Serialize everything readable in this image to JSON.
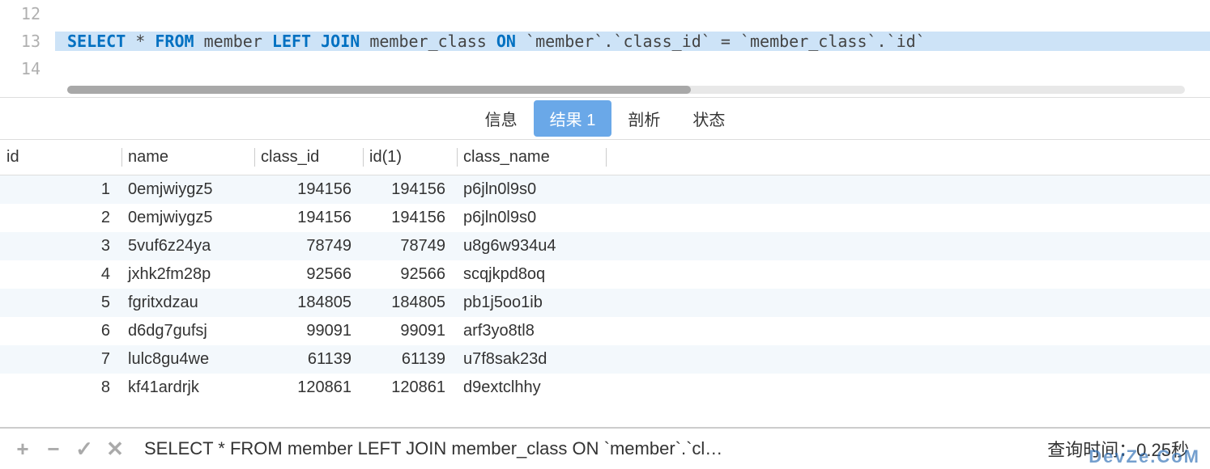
{
  "editor": {
    "lines": [
      {
        "num": "12",
        "tokens": []
      },
      {
        "num": "13",
        "selected": true,
        "sql": "SELECT * FROM member LEFT JOIN member_class ON `member`.`class_id` = `member_class`.`id`"
      },
      {
        "num": "14",
        "tokens": []
      }
    ]
  },
  "tabs": {
    "items": [
      {
        "label": "信息",
        "active": false
      },
      {
        "label": "结果 1",
        "active": true
      },
      {
        "label": "剖析",
        "active": false
      },
      {
        "label": "状态",
        "active": false
      }
    ]
  },
  "table": {
    "columns": [
      "id",
      "name",
      "class_id",
      "id(1)",
      "class_name"
    ],
    "rows": [
      {
        "id": "1",
        "name": "0emjwiygz5",
        "class_id": "194156",
        "id1": "194156",
        "class_name": "p6jln0l9s0"
      },
      {
        "id": "2",
        "name": "0emjwiygz5",
        "class_id": "194156",
        "id1": "194156",
        "class_name": "p6jln0l9s0"
      },
      {
        "id": "3",
        "name": "5vuf6z24ya",
        "class_id": "78749",
        "id1": "78749",
        "class_name": "u8g6w934u4"
      },
      {
        "id": "4",
        "name": "jxhk2fm28p",
        "class_id": "92566",
        "id1": "92566",
        "class_name": "scqjkpd8oq"
      },
      {
        "id": "5",
        "name": "fgritxdzau",
        "class_id": "184805",
        "id1": "184805",
        "class_name": "pb1j5oo1ib"
      },
      {
        "id": "6",
        "name": "d6dg7gufsj",
        "class_id": "99091",
        "id1": "99091",
        "class_name": "arf3yo8tl8"
      },
      {
        "id": "7",
        "name": "lulc8gu4we",
        "class_id": "61139",
        "id1": "61139",
        "class_name": "u7f8sak23d"
      },
      {
        "id": "8",
        "name": "kf41ardrjk",
        "class_id": "120861",
        "id1": "120861",
        "class_name": "d9extclhhy"
      }
    ]
  },
  "statusbar": {
    "query_preview": "SELECT * FROM member LEFT JOIN member_class ON `member`.`cl…",
    "time_label": "查询时间：",
    "time_value": "0.25秒",
    "watermark": "DevZe.CoM"
  }
}
